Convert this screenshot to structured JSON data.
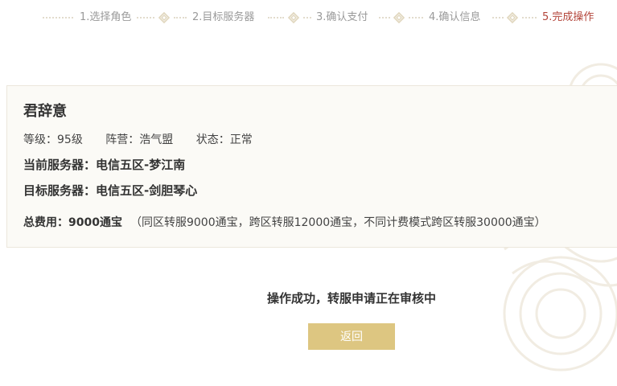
{
  "steps": [
    {
      "label": "1.选择角色",
      "active": false
    },
    {
      "label": "2.目标服务器",
      "active": false
    },
    {
      "label": "3.确认支付",
      "active": false
    },
    {
      "label": "4.确认信息",
      "active": false
    },
    {
      "label": "5.完成操作",
      "active": true
    }
  ],
  "character": {
    "name": "君辞意",
    "level": "等级：95级",
    "faction": "阵营：浩气盟",
    "status": "状态：正常",
    "current_server_label": "当前服务器：",
    "current_server": "电信五区-梦江南",
    "target_server_label": "目标服务器：",
    "target_server": "电信五区-剑胆琴心"
  },
  "fee": {
    "label": "总费用：",
    "amount": "9000通宝",
    "note": "（同区转服9000通宝，跨区转服12000通宝，不同计费模式跨区转服30000通宝）"
  },
  "result": {
    "message": "操作成功，转服申请正在审核中",
    "back_label": "返回"
  },
  "colors": {
    "active_step": "#b3453a",
    "inactive_step": "#9a9a9a",
    "button_bg": "#ddc681",
    "card_bg": "#fbfaf6"
  }
}
